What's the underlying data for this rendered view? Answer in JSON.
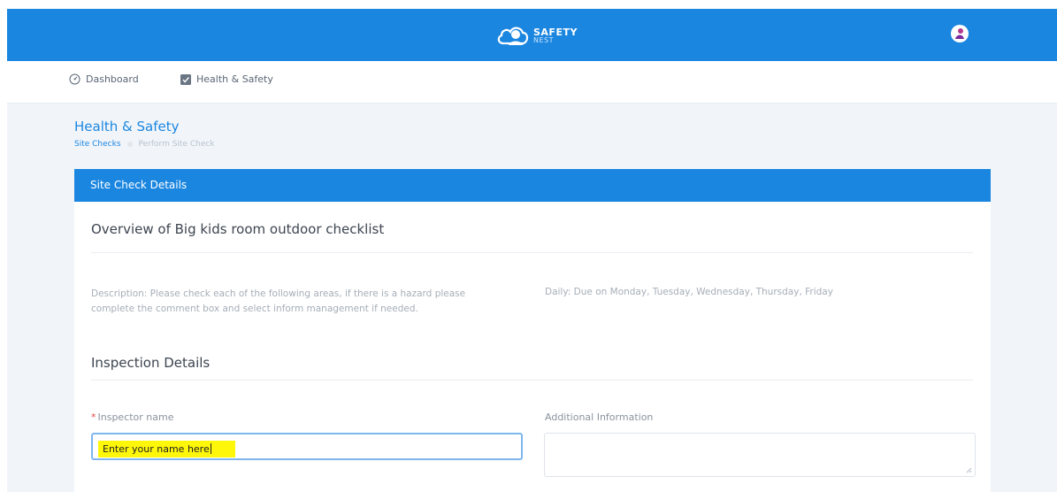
{
  "header": {
    "logo_line1": "SAFETY",
    "logo_line2": "NEST"
  },
  "nav": {
    "items": [
      {
        "label": "Dashboard",
        "icon": "dashboard-gauge-icon"
      },
      {
        "label": "Health & Safety",
        "icon": "checklist-icon"
      }
    ]
  },
  "page": {
    "title": "Health & Safety",
    "breadcrumb": {
      "link": "Site Checks",
      "current": "Perform Site Check"
    }
  },
  "card": {
    "header": "Site Check Details",
    "overview_title": "Overview of Big kids room outdoor checklist",
    "description": "Description: Please check each of the following areas, if there is a hazard please complete the comment box and select inform management if needed.",
    "schedule": "Daily: Due on Monday, Tuesday, Wednesday, Thursday, Friday",
    "inspection_title": "Inspection Details",
    "inspector_label": "Inspector name",
    "inspector_value": "Enter your name here",
    "additional_label": "Additional Information",
    "additional_value": ""
  },
  "colors": {
    "primary": "#1b86e0",
    "highlight": "#fff70a",
    "background": "#f1f5fa"
  }
}
